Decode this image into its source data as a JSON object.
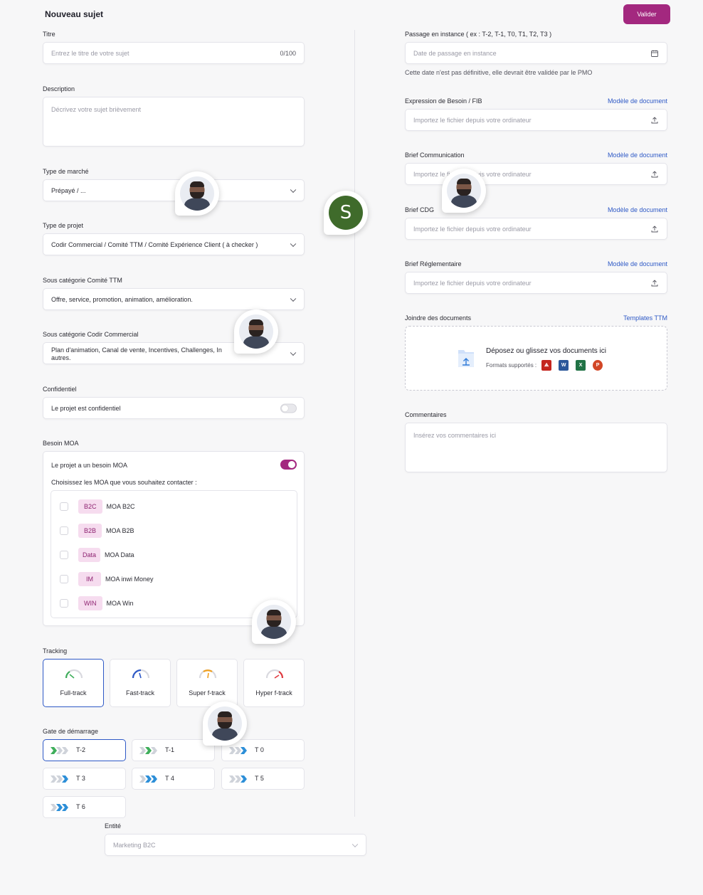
{
  "header": {
    "title": "Nouveau sujet",
    "validate_label": "Valider"
  },
  "left": {
    "titre": {
      "label": "Titre",
      "placeholder": "Entrez le titre de votre sujet",
      "counter": "0/100"
    },
    "description": {
      "label": "Description",
      "placeholder": "Décrivez votre sujet brièvement"
    },
    "type_marche": {
      "label": "Type de marché",
      "value": "Prépayé / ..."
    },
    "type_projet": {
      "label": "Type de projet",
      "value": "Codir Commercial / Comité TTM / Comité Expérience Client ( à checker )"
    },
    "sous_cat_ttm": {
      "label": "Sous catégorie Comité TTM",
      "value": "Offre, service, promotion, animation, amélioration."
    },
    "sous_cat_codir": {
      "label": "Sous catégorie Codir Commercial",
      "value_line1": "Plan d'animation, Canal de vente, Incentives, Challenges, In",
      "value_line2": "autres."
    },
    "confidentiel": {
      "label": "Confidentiel",
      "text": "Le projet est confidentiel",
      "on": false
    },
    "besoin_moa": {
      "label": "Besoin MOA",
      "text": "Le projet a un besoin MOA",
      "on": true,
      "choose_text": "Choisissez les MOA que vous souhaitez contacter :",
      "items": [
        {
          "badge": "B2C",
          "name": "MOA B2C"
        },
        {
          "badge": "B2B",
          "name": "MOA B2B"
        },
        {
          "badge": "Data",
          "name": "MOA Data"
        },
        {
          "badge": "IM",
          "name": "MOA inwi Money"
        },
        {
          "badge": "WIN",
          "name": "MOA Win"
        }
      ]
    },
    "tracking": {
      "label": "Tracking",
      "options": [
        {
          "name": "Full-track",
          "color": "#3fae5b",
          "selected": true
        },
        {
          "name": "Fast-track",
          "color": "#2e59c6",
          "selected": false
        },
        {
          "name": "Super f-track",
          "color": "#f0a020",
          "selected": false
        },
        {
          "name": "Hyper f-track",
          "color": "#e0393e",
          "selected": false
        }
      ]
    },
    "gate": {
      "label": "Gate de démarrage",
      "options": [
        {
          "name": "T-2",
          "selected": true
        },
        {
          "name": "T-1",
          "selected": false
        },
        {
          "name": "T 0",
          "selected": false
        },
        {
          "name": "T 3",
          "selected": false
        },
        {
          "name": "T 4",
          "selected": false
        },
        {
          "name": "T 5",
          "selected": false
        },
        {
          "name": "T 6",
          "selected": false
        }
      ]
    },
    "entite": {
      "label": "Entité",
      "placeholder": "Marketing B2C"
    }
  },
  "right": {
    "passage": {
      "label": "Passage en instance ( ex : T-2, T-1, T0, T1, T2, T3 )",
      "placeholder": "Date de passage en instance",
      "hint": "Cette date n'est pas définitive, elle devrait être validée par le PMO"
    },
    "uploads": [
      {
        "label": "Expression de Besoin / FIB",
        "link": "Modèle de document",
        "placeholder": "Importez le fichier depuis votre ordinateur"
      },
      {
        "label": "Brief Communication",
        "link": "Modèle de document",
        "placeholder": "Importez le fichier depuis votre ordinateur"
      },
      {
        "label": "Brief CDG",
        "link": "Modèle de document",
        "placeholder": "Importez le fichier depuis votre ordinateur"
      },
      {
        "label": "Brief Réglementaire",
        "link": "Modèle de document",
        "placeholder": "Importez le fichier depuis votre ordinateur"
      }
    ],
    "joindre": {
      "label": "Joindre des documents",
      "link": "Templates TTM",
      "drop_title": "Déposez ou glissez vos documents ici",
      "formats_label": "Formats supportés :"
    },
    "commentaires": {
      "label": "Commentaires",
      "placeholder": "Insérez vos commentaires ici"
    }
  },
  "collaborator_initial": "S",
  "colors": {
    "accent": "#a3287f",
    "link": "#2e59c6",
    "selected_border": "#2e59c6"
  }
}
